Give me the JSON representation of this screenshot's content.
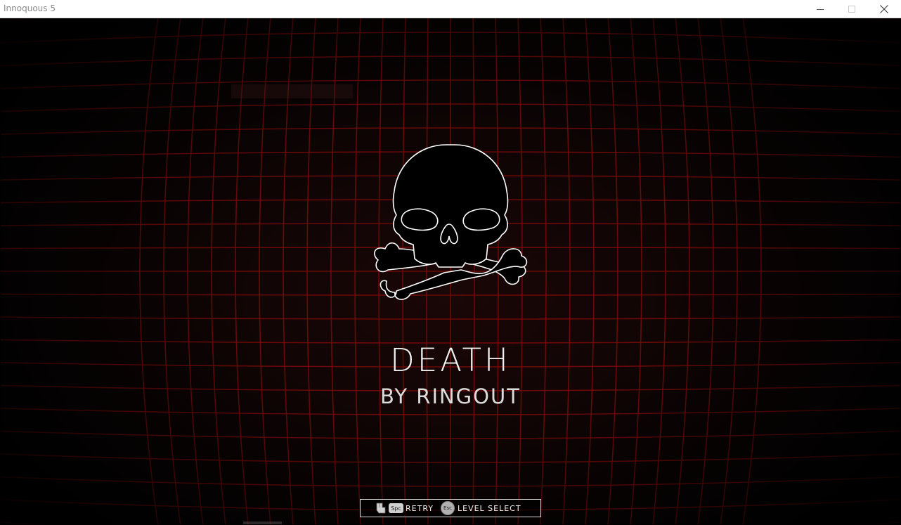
{
  "window": {
    "title": "Innoquous 5",
    "controls": [
      "minimize-icon",
      "maximize-icon",
      "close-icon"
    ]
  },
  "death_screen": {
    "title": "DEATH",
    "subtitle": "BY RINGOUT",
    "icon": "skull-and-crossbones-icon"
  },
  "prompt": {
    "retry_key": "Spc",
    "retry_label": "RETRY",
    "level_select_key": "Esc",
    "level_select_label": "LEVEL SELECT"
  },
  "colors": {
    "grid": "#7a0a0a",
    "background": "#000000",
    "text": "#f2f2f2"
  }
}
